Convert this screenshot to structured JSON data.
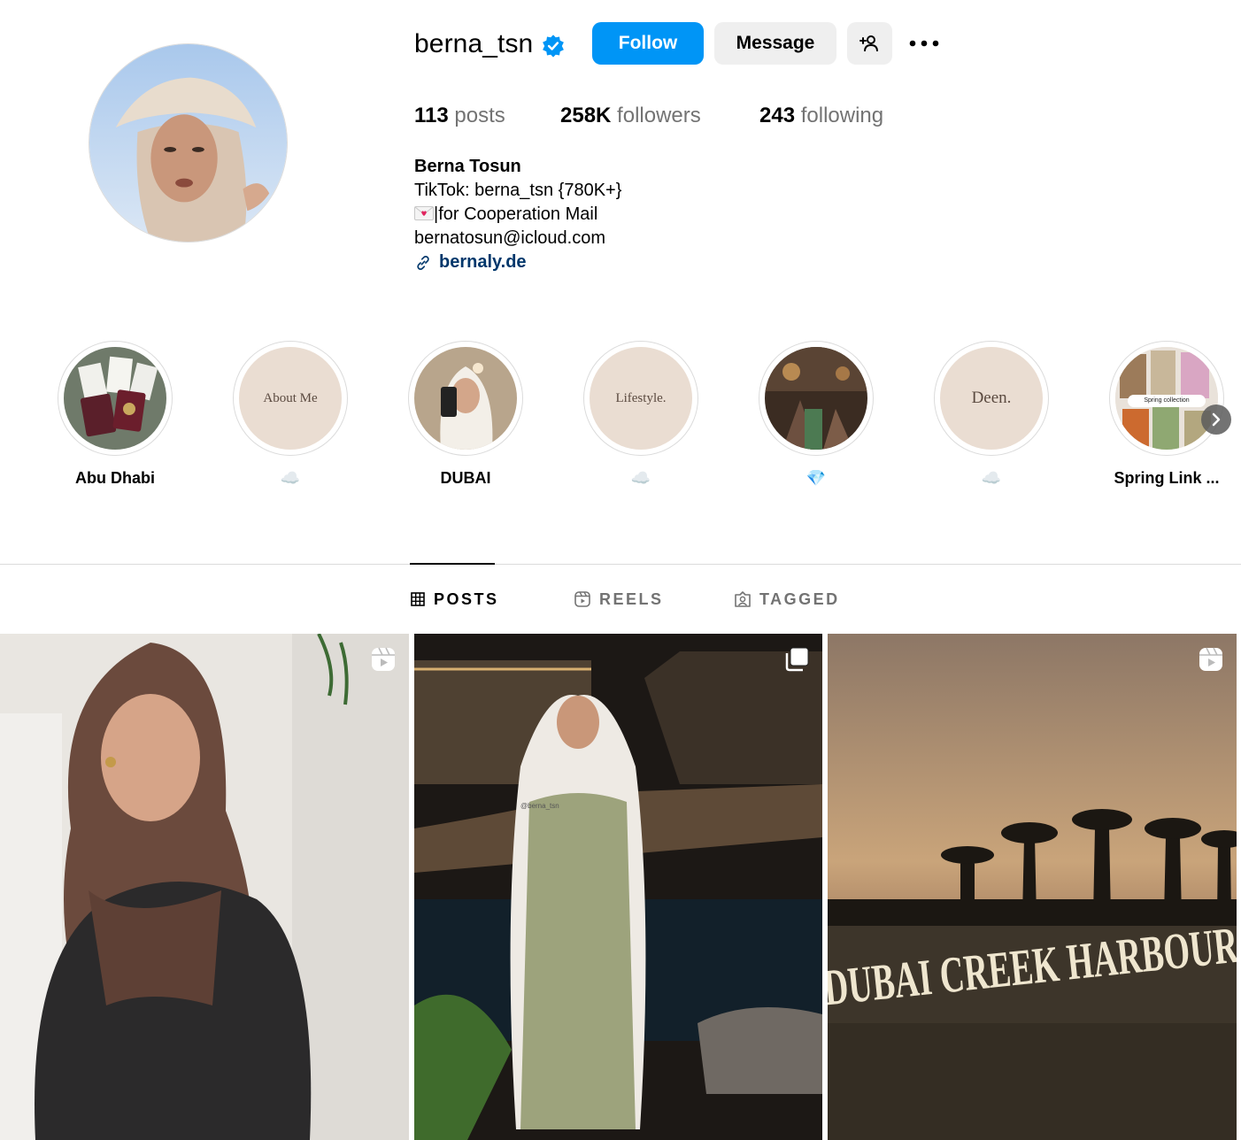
{
  "profile": {
    "username": "berna_tsn",
    "verified": true,
    "follow_label": "Follow",
    "message_label": "Message",
    "add_user_icon": "person-add-icon",
    "more_icon": "more-horizontal-icon"
  },
  "stats": {
    "posts_count": "113",
    "posts_label": "posts",
    "followers_count": "258K",
    "followers_label": "followers",
    "following_count": "243",
    "following_label": "following"
  },
  "bio": {
    "full_name": "Berna Tosun",
    "line1": "TikTok: berna_tsn {780K+}",
    "line2": "|for Cooperation Mail",
    "line3": "bernatosun@icloud.com",
    "link": "bernaly.de"
  },
  "highlights": [
    {
      "label": "Abu Dhabi",
      "cover_text": ""
    },
    {
      "label": "☁️",
      "cover_text": "About Me"
    },
    {
      "label": "DUBAI",
      "cover_text": ""
    },
    {
      "label": "☁️",
      "cover_text": "Lifestyle."
    },
    {
      "label": "💎",
      "cover_text": ""
    },
    {
      "label": "☁️",
      "cover_text": "Deen."
    },
    {
      "label": "Spring Link ...",
      "cover_text": "Spring collection"
    }
  ],
  "tabs": {
    "posts": "POSTS",
    "reels": "REELS",
    "tagged": "TAGGED",
    "active": "posts"
  },
  "posts": [
    {
      "type": "reel",
      "badge_icon": "reels-icon"
    },
    {
      "type": "carousel",
      "badge_icon": "carousel-icon"
    },
    {
      "type": "reel",
      "badge_icon": "reels-icon",
      "overlay_text": "DUBAI CREEK HARBOUR",
      "watermark": "@berna_tsn"
    }
  ],
  "colors": {
    "accent": "#0095f6",
    "link": "#00376b",
    "secondary_text": "#737373",
    "button_gray": "#efefef",
    "highlight_beige": "#eaddd2"
  }
}
